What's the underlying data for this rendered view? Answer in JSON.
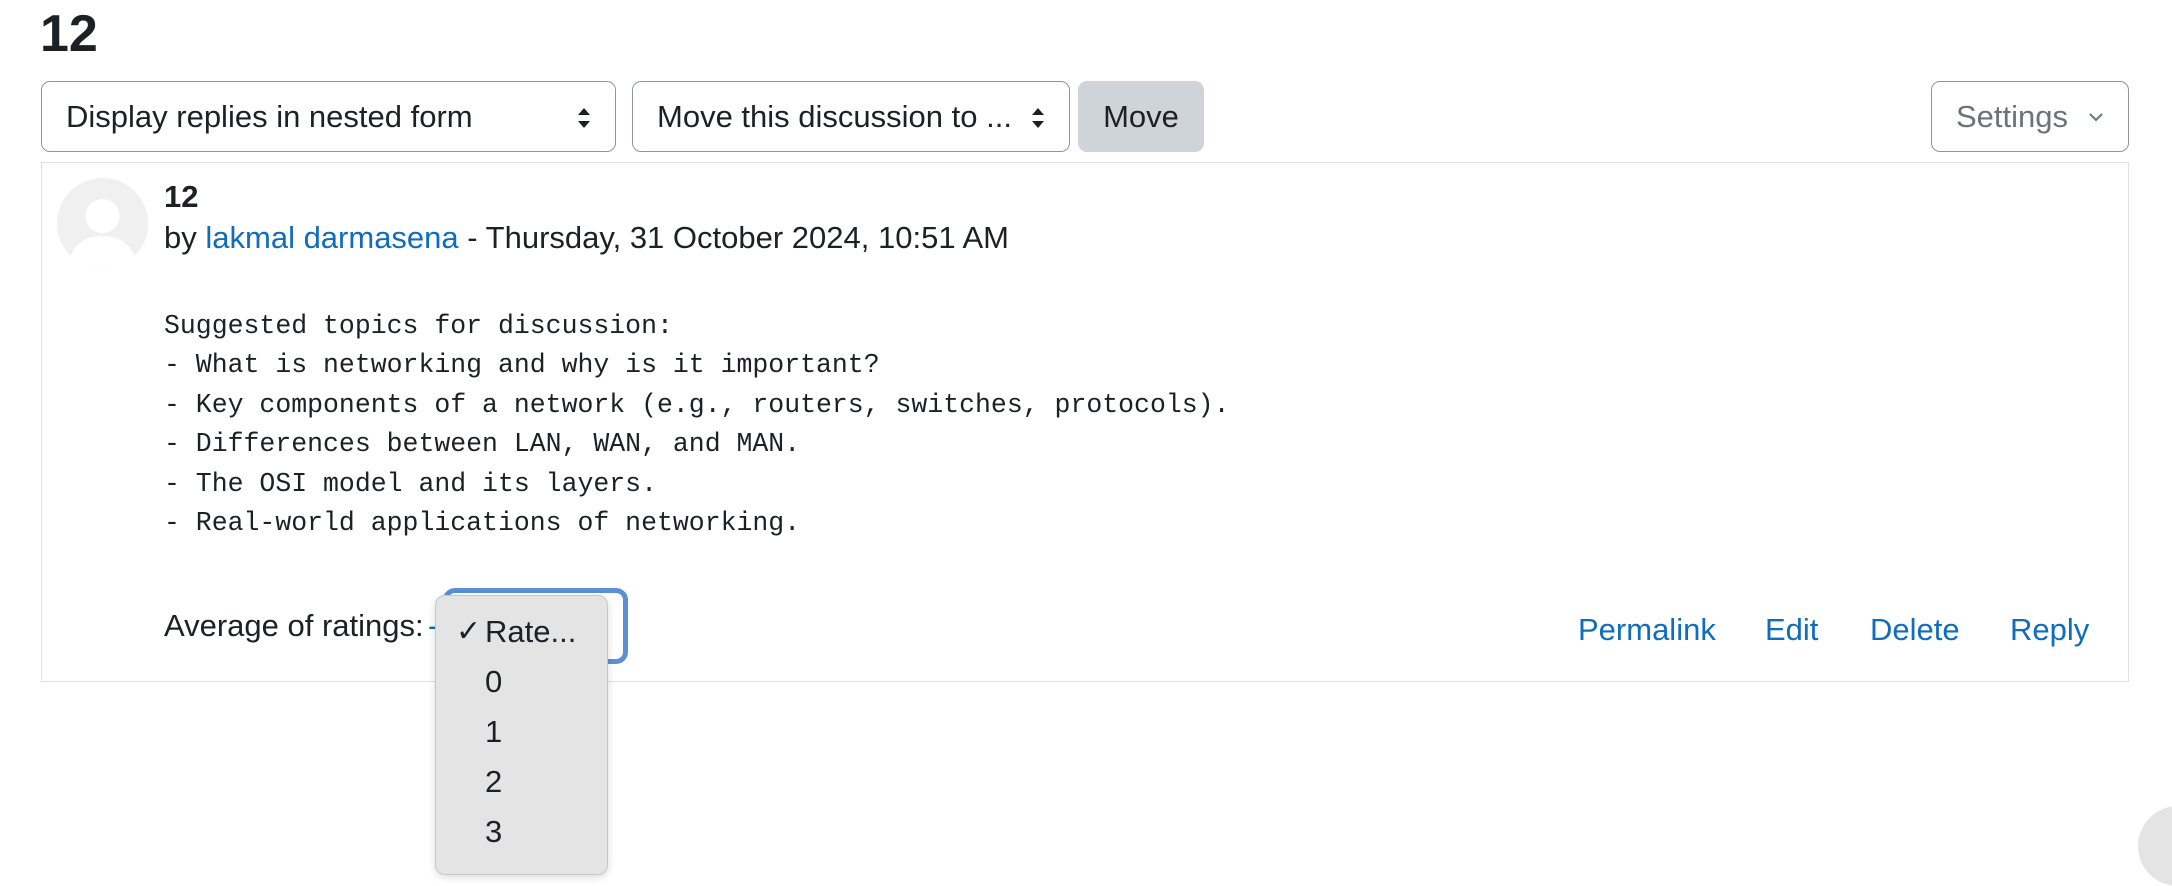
{
  "page": {
    "title": "12"
  },
  "toolbar": {
    "display_mode_value": "Display replies in nested form",
    "move_target_value": "Move this discussion to ...",
    "move_label": "Move",
    "settings_label": "Settings"
  },
  "post": {
    "subject": "12",
    "by_prefix": "by",
    "author": "lakmal darmasena",
    "date_text": "- Thursday, 31 October 2024, 10:51 AM",
    "message_lines": [
      "Suggested topics for discussion:",
      "- What is networking and why is it important?",
      "- Key components of a network (e.g., routers, switches, protocols).",
      "- Differences between LAN, WAN, and MAN.",
      "- The OSI model and its layers.",
      "- Real-world applications of networking."
    ],
    "ratings_label": "Average of ratings:",
    "ratings_value": "-",
    "actions": {
      "permalink": "Permalink",
      "edit": "Edit",
      "delete": "Delete",
      "reply": "Reply"
    }
  },
  "rating_dropdown": {
    "selected_check": "✓",
    "options": [
      "Rate...",
      "0",
      "1",
      "2",
      "3"
    ]
  },
  "colors": {
    "link": "#0f6cbf",
    "focus_ring": "#5b90d6",
    "move_button_bg": "#ced4da",
    "dropdown_bg": "#e4e4e4"
  },
  "icons": {
    "display_select_arrows": "sort-arrows-icon",
    "move_select_arrows": "sort-arrows-icon",
    "settings_chevron": "chevron-down-icon",
    "avatar": "default-user-avatar-icon",
    "selected_option": "checkmark-icon"
  }
}
